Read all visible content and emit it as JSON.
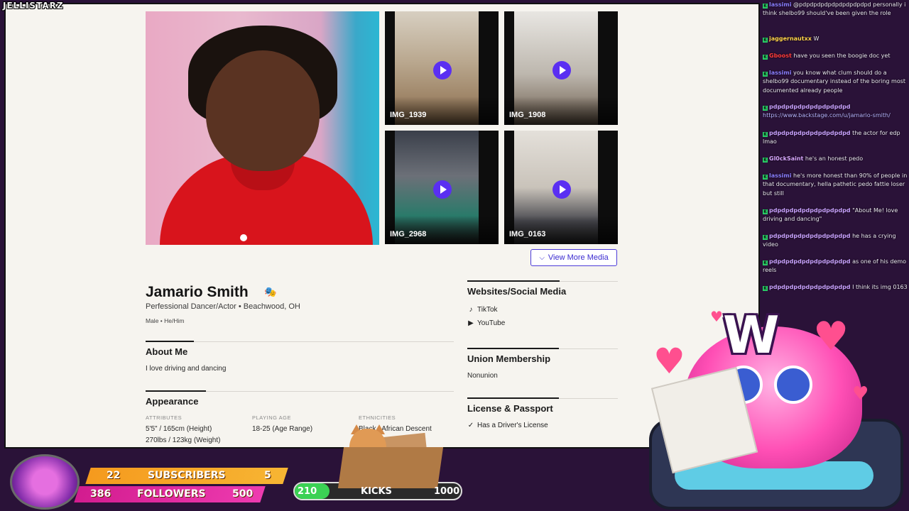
{
  "overlay": {
    "brand": "JELLISTARZ"
  },
  "profile": {
    "name": "Jamario Smith",
    "tagline": "Perfessional Dancer/Actor • Beachwood, OH",
    "gender": "Male • He/Him",
    "view_more_label": "View More Media",
    "media": [
      {
        "label": "IMG_1939"
      },
      {
        "label": "IMG_1908"
      },
      {
        "label": "IMG_2968"
      },
      {
        "label": "IMG_0163"
      }
    ],
    "about_title": "About Me",
    "about_text": "I love driving and dancing",
    "appearance_title": "Appearance",
    "attributes_head": "ATTRIBUTES",
    "attributes_1": "5'5\" / 165cm (Height)",
    "attributes_2": "270lbs / 123kg (Weight)",
    "playing_age_head": "PLAYING AGE",
    "playing_age": "18-25 (Age Range)",
    "ethnicities_head": "ETHNICITIES",
    "ethnicities": "Black / African Descent",
    "social_title": "Websites/Social Media",
    "social_links": [
      "TikTok",
      "YouTube"
    ],
    "union_title": "Union Membership",
    "union_value": "Nonunion",
    "license_title": "License & Passport",
    "license_value": "Has a Driver's License"
  },
  "chat": [
    {
      "user": "lassimi",
      "text": "@pdpdpdpdpdpdpdpdpdpd personally i think shelbo99 should've been given the role"
    },
    {
      "user": "jaggernautxx",
      "text": "W"
    },
    {
      "user": "Gboost",
      "text": "have you seen the boogie doc yet"
    },
    {
      "user": "lassimi",
      "text": "you know what clum should do a shelbo99 documentary instead of the boring most documented already people"
    },
    {
      "user": "pdpdpdpdpdpdpdpdpdpd",
      "text": "https://www.backstage.com/u/jamario-smith/"
    },
    {
      "user": "pdpdpdpdpdpdpdpdpdpd",
      "text": "the actor for edp lmao"
    },
    {
      "user": "Gl0ckSaint",
      "text": "he's an honest pedo"
    },
    {
      "user": "lassimi",
      "text": "he's more honest than 90% of people in that documentary, hella pathetic pedo fattie loser but still"
    },
    {
      "user": "pdpdpdpdpdpdpdpdpdpd",
      "text": "\"About Me! love driving and dancing\""
    },
    {
      "user": "pdpdpdpdpdpdpdpdpdpd",
      "text": "he has a crying video"
    },
    {
      "user": "pdpdpdpdpdpdpdpdpdpd",
      "text": "as one of his demo reels"
    },
    {
      "user": "pdpdpdpdpdpdpdpdpdpd",
      "text": "I think its img 0163"
    }
  ],
  "mascot": {
    "letter": "W"
  },
  "stats": {
    "subscribers_current": "22",
    "subscribers_label": "SUBSCRIBERS",
    "subscribers_goal": "5",
    "followers_current": "386",
    "followers_label": "FOLLOWERS",
    "followers_goal": "500",
    "kicks_current": "210",
    "kicks_label": "KICKS",
    "kicks_goal": "1000",
    "kicks_progress": 0.21
  },
  "colors": {
    "accent": "#5a2ff2",
    "subs_strip": "#f59a1e",
    "followers_strip": "#d21c8f",
    "kicks_fill": "#3bd154"
  }
}
